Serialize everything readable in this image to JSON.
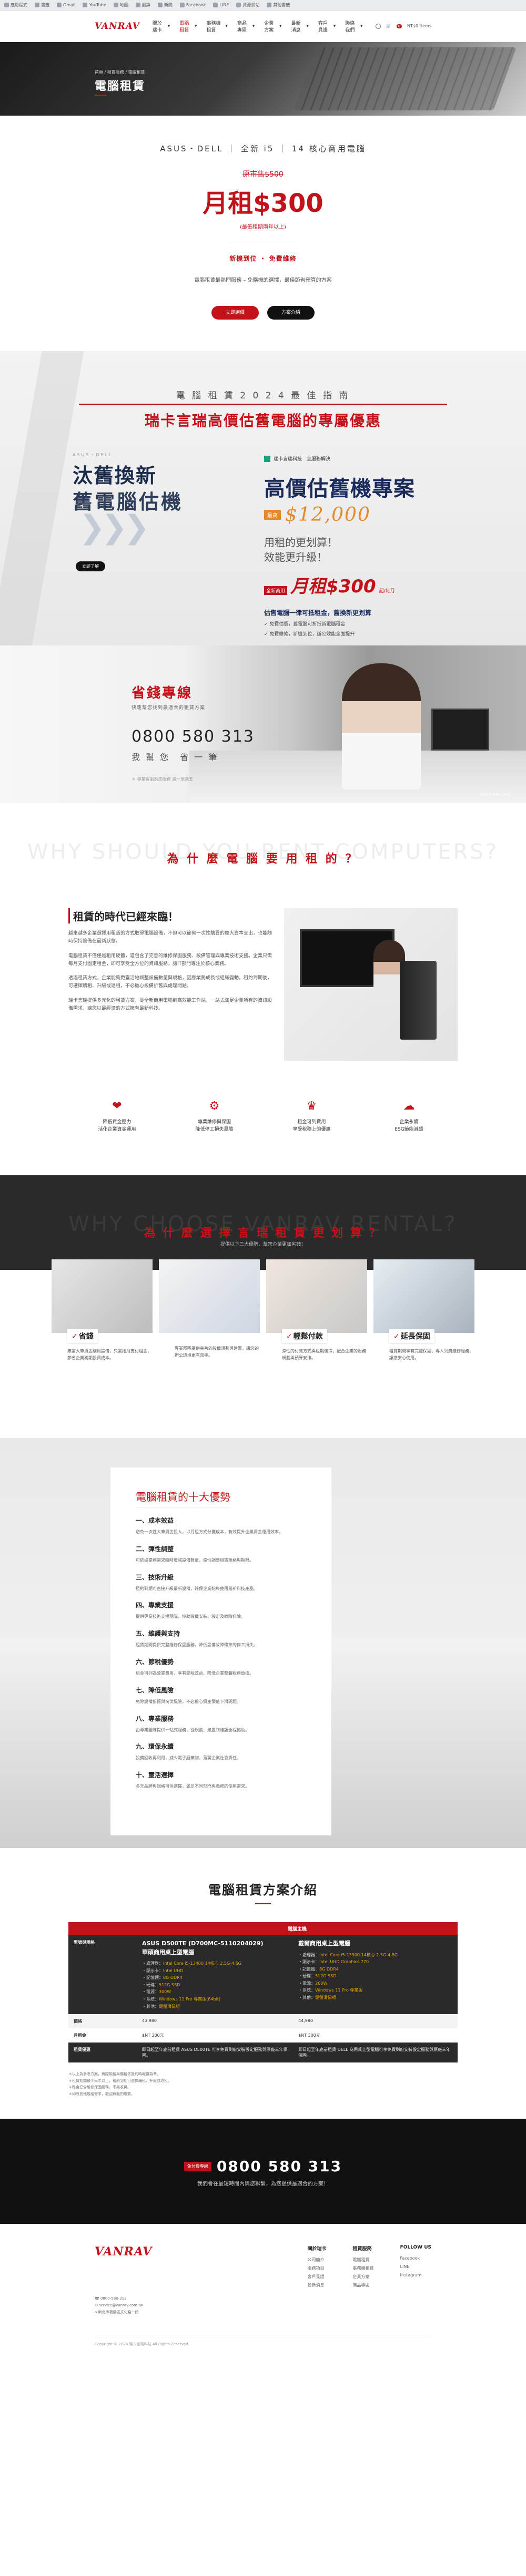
{
  "browser": {
    "bookmarks": [
      "應用程式",
      "書籤",
      "Gmail",
      "YouTube",
      "地圖",
      "翻譯",
      "新聞",
      "Facebook",
      "LINE",
      "資源網站",
      "其他書籤"
    ]
  },
  "header": {
    "logo": "VANRAV",
    "nav": [
      {
        "label": "關於瑞卡"
      },
      {
        "label": "電腦租賃",
        "active": true
      },
      {
        "label": "事務機租賃"
      },
      {
        "label": "商品專區"
      },
      {
        "label": "企業方案"
      },
      {
        "label": "最新消息"
      },
      {
        "label": "客戶見證"
      },
      {
        "label": "聯絡我們"
      }
    ],
    "cart_count": "0",
    "cart_label": "NT$0 Items"
  },
  "banner": {
    "breadcrumb": "首頁 / 租賃服務 / 電腦租賃",
    "title": "電腦租賃"
  },
  "pricing": {
    "spec_line": "ASUS・DELL ｜ 全新 i5 ｜ 14 核心商用電腦",
    "original_price": "原市售$500",
    "price": "月租$300",
    "price_note": "(最低租期兩年以上)",
    "features": "新機到位 ・ 免費維修",
    "sub": "電腦租賃最熱門服務 – 免購機的選擇，最佳節省預算的方案",
    "buttons": {
      "primary": "立即詢價",
      "secondary": "方案介紹"
    }
  },
  "guide": {
    "kicker": "電 腦 租 賃 2 0 2 4 最 佳 指 南",
    "headline": "瑞卡言瑞高價估舊電腦的專屬優惠",
    "left_label": "ASUS・DELL",
    "left_line1": "汰舊換新",
    "left_line2": "舊電腦估機",
    "chevrons": "❯❯❯",
    "left_button": "立即了解",
    "brand": "瑞卡言瑞科技　全服務解決",
    "right_h": "高價估舊機專案",
    "amount_tag": "最高",
    "amount": "$12,000",
    "question1": "用租的更划算！",
    "question2": "效能更升級！",
    "monthly_tag": "全新商用",
    "monthly": "月租$300",
    "monthly_small": "起/每月",
    "desc": "估售電腦一律可抵租金，舊換新更划算",
    "lines": [
      "✓ 免費估價，舊電腦可折抵新電腦租金",
      "✓ 免費維修，新機到位，辦公效能全面提升"
    ]
  },
  "hotline": {
    "title": "省錢專線",
    "subtitle": "快速幫您找到最適合的租賃方案",
    "number": "0800 580 313",
    "number_alt": "我 幫 您　省 一 筆",
    "footnote": "＊ 專業客服為您服務 週一至週五",
    "watermark": "SHUTTERSTOCK"
  },
  "why": {
    "watermark": "WHY SHOULD YOU RENT COMPUTERS?",
    "heading": "為 什 麼 電 腦 要 用 租 的 ？",
    "title": "租賃的時代已經來臨！",
    "paragraphs": [
      "越來越多企業選擇用租賃的方式取得電腦設備，不但可以節省一次性購買的龐大資本支出，也能隨時保持設備在最新狀態。",
      "電腦租賃不僅僅是租用硬體，還包含了完善的維修保固服務、設備管理與專業技術支援。企業只需每月支付固定租金，即可享受全方位的資訊服務，讓IT部門專注於核心業務。",
      "透過租賃方式，企業能夠更靈活地調整設備數量與規格，因應業務成長或組織變動。租約到期後，可選擇續租、升級或退租，不必擔心設備折舊與處理問題。",
      "瑞卡言瑞提供多元化的租賃方案，從全新商用電腦到高效能工作站，一站式滿足企業所有的資訊設備需求，讓您以最經濟的方式擁有最新科技。"
    ],
    "icons": [
      {
        "glyph": "❤",
        "text": "降低資金壓力\n活化企業資金運用"
      },
      {
        "glyph": "⚙",
        "text": "專業維修與保固\n降低停工損失風險"
      },
      {
        "glyph": "♛",
        "text": "租金可列費用\n享受稅務上的優惠"
      },
      {
        "glyph": "☁",
        "text": "企業永續\nESG節能減碳"
      }
    ]
  },
  "reasons": {
    "watermark": "WHY CHOOSE VANRAV RENTAL?",
    "heading": "為 什 麼 選 擇 言 瑞 租 賃 更 划 算 ？",
    "sub": "提供以下三大優勢，幫您企業更加省錢！",
    "cards": [
      {
        "label": "省錢",
        "desc": "無需大筆資金購買設備，只需按月支付租金，節省企業初期投資成本。"
      },
      {
        "label": "",
        "desc": "專業團隊提供完善的設備規劃與建置，讓您的辦公環境更有效率。"
      },
      {
        "label": "輕鬆付款",
        "desc": "彈性的付款方式與租期選擇，配合企業的財務規劃與預算安排。"
      },
      {
        "label": "延長保固",
        "desc": "租賃期間享有完整保固，專人到府維修服務，讓您安心使用。"
      }
    ]
  },
  "advantages": {
    "title": "電腦租賃的十大優勢",
    "items": [
      {
        "h": "一、成本效益",
        "p": "避免一次性大筆資金投入，以月租方式分攤成本，有效提升企業資金運用效率。"
      },
      {
        "h": "二、彈性調整",
        "p": "可依據業務需求隨時增減設備數量，彈性調整租賃規格與期限。"
      },
      {
        "h": "三、技術升級",
        "p": "租約到期可直接升級最新設備，確保企業始終使用最新科技產品。"
      },
      {
        "h": "四、專業支援",
        "p": "提供專業技術支援團隊，協助設備安裝、設定及故障排除。"
      },
      {
        "h": "五、維護與支持",
        "p": "租賃期間提供完整維修保固服務，降低設備故障帶來的停工損失。"
      },
      {
        "h": "六、節稅優勢",
        "p": "租金可列為營業費用，享有節稅效益，降低企業整體稅務負擔。"
      },
      {
        "h": "七、降低風險",
        "p": "免除設備折舊與淘汰風險，不必擔心資產價值下滑問題。"
      },
      {
        "h": "八、專業服務",
        "p": "由專業團隊提供一站式服務，從規劃、建置到維護全程協助。"
      },
      {
        "h": "九、環保永續",
        "p": "設備回收再利用，減少電子廢棄物，落實企業社會責任。"
      },
      {
        "h": "十、靈活選擇",
        "p": "多元品牌與規格可供選擇，滿足不同部門與職務的使用需求。"
      }
    ]
  },
  "plans": {
    "title": "電腦租賃方案介紹",
    "header": "電腦主機",
    "row_labels": [
      "型號與規格",
      "價格",
      "月租金",
      "租賃優惠"
    ],
    "products": [
      {
        "name": "ASUS D500TE (D700MC-5110204029)\n華碩商用桌上型電腦",
        "specs": [
          {
            "k": "處理器",
            "v": "Intel Core i5-13400 14核心 2.5G-4.6G"
          },
          {
            "k": "顯示卡",
            "v": "Intel UHD"
          },
          {
            "k": "記憶體",
            "v": "8G DDR4"
          },
          {
            "k": "硬碟",
            "v": "512G SSD"
          },
          {
            "k": "電源",
            "v": "300W"
          },
          {
            "k": "系統",
            "v": "Windows 11 Pro 專業版(64bit)"
          },
          {
            "k": "其他",
            "v": "鍵盤滑鼠組"
          }
        ],
        "price": "43,980",
        "monthly": "$NT 300元",
        "offer": "即日起至年底前租賃 ASUS D500TE 可享免費到府安裝設定服務與原廠三年保固。"
      },
      {
        "name": "戴爾商用桌上型電腦",
        "specs": [
          {
            "k": "處理器",
            "v": "Intel Core i5-13500 14核心 2.5G-4.8G"
          },
          {
            "k": "顯示卡",
            "v": "Intel UHD Graphics 770"
          },
          {
            "k": "記憶體",
            "v": "8G DDR4"
          },
          {
            "k": "硬碟",
            "v": "512G SSD"
          },
          {
            "k": "電源",
            "v": "260W"
          },
          {
            "k": "系統",
            "v": "Windows 11 Pro 專業版"
          },
          {
            "k": "其他",
            "v": "鍵盤滑鼠組"
          }
        ],
        "price": "44,980",
        "monthly": "$NT 300元",
        "offer": "即日起至年底前租賃 DELL 商用桌上型電腦可享免費到府安裝設定服務與原廠三年保固。"
      }
    ],
    "notes": [
      "＊以上為參考方案，實際規格與價格依簽約時報價為準。",
      "＊租賃期間最少兩年以上，租約到期可選擇續租、升級或退租。",
      "＊租金已含維修保固服務，不另收費。",
      "＊如有其他規格需求，歡迎與我們聯繫。"
    ]
  },
  "cta": {
    "tag": "免付費專線",
    "number": "0800 580 313",
    "sub": "我們會在最短時間內與您聯繫，為您提供最適合的方案！"
  },
  "footer": {
    "logo": "VANRAV",
    "info": [
      "☎ 0800-580-313",
      "✉ service@vanrav.com.tw",
      "⌂ 新北市板橋區文化路一段"
    ],
    "columns": [
      {
        "title": "關於瑞卡",
        "items": [
          "公司簡介",
          "服務項目",
          "客戶見證",
          "最新消息"
        ]
      },
      {
        "title": "租賃服務",
        "items": [
          "電腦租賃",
          "事務機租賃",
          "企業方案",
          "商品專區"
        ]
      },
      {
        "title": "FOLLOW US",
        "items": [
          "Facebook",
          "LINE",
          "Instagram"
        ]
      }
    ],
    "copyright": "Copyright © 2024 瑞卡言瑞科技 All Rights Reserved."
  }
}
